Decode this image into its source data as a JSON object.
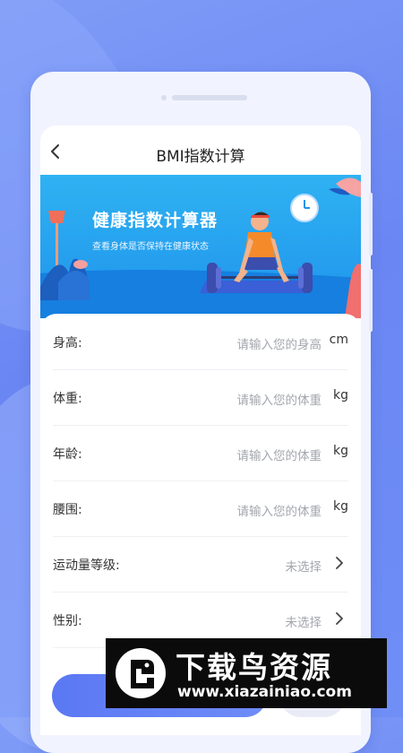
{
  "nav": {
    "title": "BMI指数计算",
    "back_icon": "chevron-left-icon"
  },
  "banner": {
    "title": "健康指数计算器",
    "subtitle": "查看身体是否保持在健康状态"
  },
  "form": {
    "rows": [
      {
        "label": "身高:",
        "placeholder": "请输入您的身高",
        "unit": "cm"
      },
      {
        "label": "体重:",
        "placeholder": "请输入您的体重",
        "unit": "kg"
      },
      {
        "label": "年龄:",
        "placeholder": "请输入您的体重",
        "unit": "kg"
      },
      {
        "label": "腰围:",
        "placeholder": "请输入您的体重",
        "unit": "kg"
      },
      {
        "label": "运动量等级:",
        "value": "未选择"
      },
      {
        "label": "性别:",
        "value": "未选择"
      }
    ]
  },
  "watermark": {
    "title": "下载鸟资源",
    "url": "www.xiazainiao.com"
  },
  "colors": {
    "accent": "#5b78f4",
    "banner": "#1f93ec",
    "background": "#7f9cf7"
  }
}
